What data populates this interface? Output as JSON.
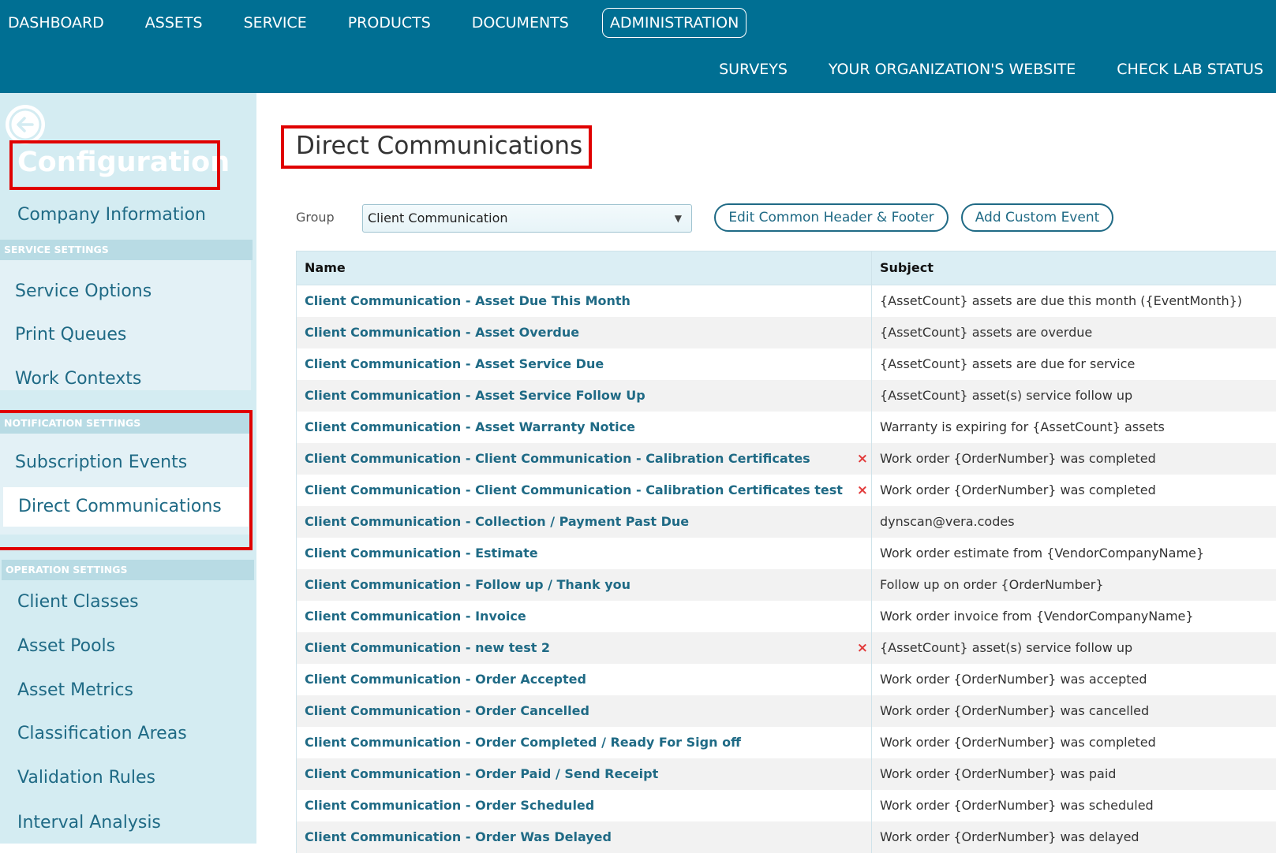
{
  "topnav": {
    "items": [
      "DASHBOARD",
      "ASSETS",
      "SERVICE",
      "PRODUCTS",
      "DOCUMENTS",
      "ADMINISTRATION"
    ],
    "active": "ADMINISTRATION"
  },
  "subnav": {
    "items": [
      "SURVEYS",
      "YOUR ORGANIZATION'S WEBSITE",
      "CHECK LAB STATUS"
    ]
  },
  "sidebar": {
    "title": "Configuration",
    "company_info": "Company Information",
    "sections": {
      "service": {
        "header": "SERVICE SETTINGS",
        "items": [
          "Service Options",
          "Print Queues",
          "Work Contexts"
        ]
      },
      "notification": {
        "header": "NOTIFICATION SETTINGS",
        "items": [
          "Subscription Events",
          "Direct Communications"
        ],
        "active": "Direct Communications"
      },
      "operation": {
        "header": "OPERATION SETTINGS",
        "items": [
          "Client Classes",
          "Asset Pools",
          "Asset Metrics",
          "Classification Areas",
          "Validation Rules",
          "Interval Analysis"
        ]
      }
    }
  },
  "main": {
    "title": "Direct Communications",
    "group_label": "Group",
    "group_value": "Client Communication",
    "edit_header_footer_label": "Edit Common Header & Footer",
    "add_custom_event_label": "Add Custom Event",
    "table": {
      "columns": [
        "Name",
        "Subject"
      ],
      "rows": [
        {
          "name": "Client Communication - Asset Due This Month",
          "subject": "{AssetCount} assets are due this month ({EventMonth})",
          "deletable": false
        },
        {
          "name": "Client Communication - Asset Overdue",
          "subject": "{AssetCount} assets are overdue",
          "deletable": false
        },
        {
          "name": "Client Communication - Asset Service Due",
          "subject": "{AssetCount} assets are due for service",
          "deletable": false
        },
        {
          "name": "Client Communication - Asset Service Follow Up",
          "subject": "{AssetCount} asset(s) service follow up",
          "deletable": false
        },
        {
          "name": "Client Communication - Asset Warranty Notice",
          "subject": "Warranty is expiring for {AssetCount} assets",
          "deletable": false
        },
        {
          "name": "Client Communication - Client Communication - Calibration Certificates",
          "subject": "Work order {OrderNumber} was completed",
          "deletable": true
        },
        {
          "name": "Client Communication - Client Communication - Calibration Certificates test",
          "subject": "Work order {OrderNumber} was completed",
          "deletable": true
        },
        {
          "name": "Client Communication - Collection / Payment Past Due",
          "subject": "dynscan@vera.codes",
          "deletable": false
        },
        {
          "name": "Client Communication - Estimate",
          "subject": "Work order estimate from {VendorCompanyName}",
          "deletable": false
        },
        {
          "name": "Client Communication - Follow up / Thank you",
          "subject": "Follow up on order {OrderNumber}",
          "deletable": false
        },
        {
          "name": "Client Communication - Invoice",
          "subject": "Work order invoice from {VendorCompanyName}",
          "deletable": false
        },
        {
          "name": "Client Communication - new test 2",
          "subject": "{AssetCount} asset(s) service follow up",
          "deletable": true
        },
        {
          "name": "Client Communication - Order Accepted",
          "subject": "Work order {OrderNumber} was accepted",
          "deletable": false
        },
        {
          "name": "Client Communication - Order Cancelled",
          "subject": "Work order {OrderNumber} was cancelled",
          "deletable": false
        },
        {
          "name": "Client Communication - Order Completed / Ready For Sign off",
          "subject": "Work order {OrderNumber} was completed",
          "deletable": false
        },
        {
          "name": "Client Communication - Order Paid / Send Receipt",
          "subject": "Work order {OrderNumber} was paid",
          "deletable": false
        },
        {
          "name": "Client Communication - Order Scheduled",
          "subject": "Work order {OrderNumber} was scheduled",
          "deletable": false
        },
        {
          "name": "Client Communication - Order Was Delayed",
          "subject": "Work order {OrderNumber} was delayed",
          "deletable": false
        }
      ]
    },
    "delete_icon": "×"
  },
  "colors": {
    "topbar": "#006f93",
    "sidebar": "#d4ecf2",
    "link": "#1f6a85",
    "highlight": "#e00000",
    "delete": "#e23b3b"
  }
}
